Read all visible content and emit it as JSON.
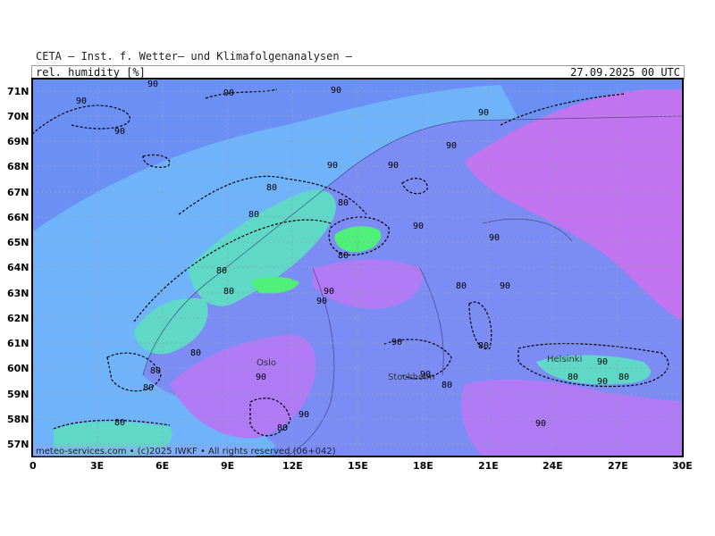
{
  "header": {
    "title": "CETA — Inst. f. Wetter— und Klimafolgenanalysen —",
    "variable": "rel. humidity [%]",
    "valid_time": "27.09.2025 00 UTC"
  },
  "footer": {
    "credit": "meteo-services.com • (c)2025 IWKF • All rights reserved (06+042)"
  },
  "axes": {
    "lat_labels": [
      "71N",
      "70N",
      "69N",
      "68N",
      "67N",
      "66N",
      "65N",
      "64N",
      "63N",
      "62N",
      "61N",
      "60N",
      "59N",
      "58N",
      "57N"
    ],
    "lon_labels": [
      "0",
      "3E",
      "6E",
      "9E",
      "12E",
      "15E",
      "18E",
      "21E",
      "24E",
      "27E",
      "30E"
    ]
  },
  "cities": [
    "Oslo",
    "Stockholm",
    "Helsinki"
  ],
  "contour_label": "90",
  "contour_label_alt": "80",
  "colors": {
    "ocean_blue": "#6a8ff5",
    "light_blue": "#6fb4fb",
    "teal": "#5fd8c8",
    "green": "#4ef07a",
    "violet": "#b07af5",
    "magenta": "#c173f0",
    "land_blue": "#7b8cf4"
  }
}
